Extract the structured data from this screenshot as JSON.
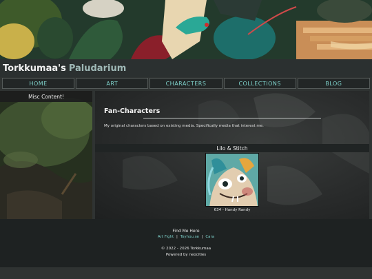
{
  "site": {
    "title_main": "Torkkumaa's",
    "title_accent": "Paludarium"
  },
  "nav": {
    "items": [
      {
        "label": "HOME"
      },
      {
        "label": "ART"
      },
      {
        "label": "CHARACTERS"
      },
      {
        "label": "COLLECTIONS"
      },
      {
        "label": "BLOG"
      }
    ]
  },
  "sidebar": {
    "heading": "Misc Content!"
  },
  "main": {
    "section_title": "Fan-Characters",
    "section_desc": "My original characters based on existing media. Specifically media that interest me.",
    "group_heading": "Lilo & Stitch",
    "card": {
      "caption": "634 - Handy Randy"
    }
  },
  "footer": {
    "heading": "Find Me Here",
    "links": [
      {
        "label": "Art Fight"
      },
      {
        "label": "Toyhou.se"
      },
      {
        "label": "Cara"
      }
    ],
    "separator": "|",
    "copyright": "© 2022 - 2026 Torkkumaa",
    "powered": "Powered by neocities"
  },
  "colors": {
    "accent": "#7fd3cc",
    "background": "#2f3332",
    "nav_border": "#545a59"
  }
}
